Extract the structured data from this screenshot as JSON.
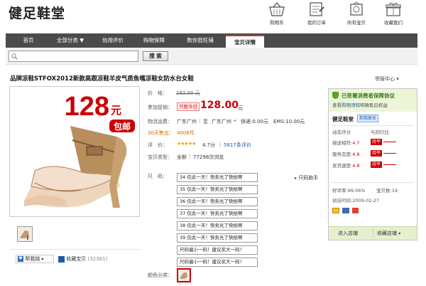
{
  "shop": {
    "name": "健足鞋堂"
  },
  "header_links": [
    {
      "icon": "basket-icon",
      "label": "购物车"
    },
    {
      "icon": "order-icon",
      "label": "我的订单"
    },
    {
      "icon": "goods-icon",
      "label": "所有宝贝"
    },
    {
      "icon": "gift-icon",
      "label": "收藏我们"
    }
  ],
  "nav": {
    "items": [
      "首页",
      "全部分类 ▼",
      "信用评价",
      "购物保障",
      "数你逛旺铺",
      "宝贝详情"
    ],
    "active": "宝贝详情"
  },
  "search": {
    "button": "搜 索"
  },
  "product": {
    "title": "品牌凉鞋STFOX2012新款高跟凉鞋羊皮气质鱼嘴凉鞋女防水台女鞋",
    "report": "举报中心",
    "image_price": "128",
    "image_currency": "元",
    "image_tag": "包邮"
  },
  "details": {
    "price_label": "价　格：",
    "price": "182.00 元",
    "promo_label": "参加促销：",
    "promo_badge": "只限今日",
    "promo_price": "128.00",
    "promo_unit": "元",
    "shipping_label": "物流运费：",
    "shipping_from": "广东广州",
    "shipping_sep": "至",
    "shipping_to": "广东广州",
    "shipping_express": "快递:0.00元",
    "shipping_ems": "EMS:10.00元",
    "sold_days": "30天售出：",
    "sold_count": "4006件",
    "rating_label": "评　价：",
    "rating_score": "4.7分",
    "rating_count": "5817条评价",
    "type_label": "宝贝类型：",
    "type_value": "全新",
    "type_views": "77298次浏览",
    "size_label": "尺　码：",
    "size_helper": "尺码助手",
    "sizes": [
      "34 仅此一天！快卖光了快抢啊",
      "35 仅此一天！快卖光了快抢啊",
      "36 仅此一天！快卖光了快抢啊",
      "37 仅此一天！快卖光了快抢啊",
      "38 仅此一天！快卖光了快抢啊",
      "39 仅此一天！快卖光了快抢啊",
      "尺码偏小一码！建议买大一码！",
      "尺码偏小一码！建议买大一码！"
    ],
    "color_label": "颜色分类："
  },
  "actions": {
    "share": "帮我挑",
    "favorite": "收藏宝贝",
    "favorite_count": "(32381)"
  },
  "sidebar": {
    "guarantee_title": "已签署消费者保障协议",
    "guarantee_sub": "查看",
    "guarantee_link": "购物须知",
    "guarantee_tail": "明确售后权益",
    "seller": "健足鞋堂",
    "contact": "和我联系",
    "score_title": "动态评分",
    "compare_title": "与同行比",
    "scores": [
      {
        "label": "描述相符:",
        "value": "4.7",
        "badge": "持平"
      },
      {
        "label": "服务态度:",
        "value": "4.8",
        "badge": "持平"
      },
      {
        "label": "发货速度:",
        "value": "4.8",
        "badge": "持平"
      }
    ],
    "good_rate": "好评率:99.06%",
    "credit": "宝贝数:19",
    "created": "创店时间:2009-02-27",
    "enter_shop": "进入店铺",
    "fav_shop": "收藏店铺"
  },
  "colors": {
    "nav_bg": "#4b4b4b",
    "price_red": "#cc0000",
    "sidebar_green": "#edf5d9"
  }
}
